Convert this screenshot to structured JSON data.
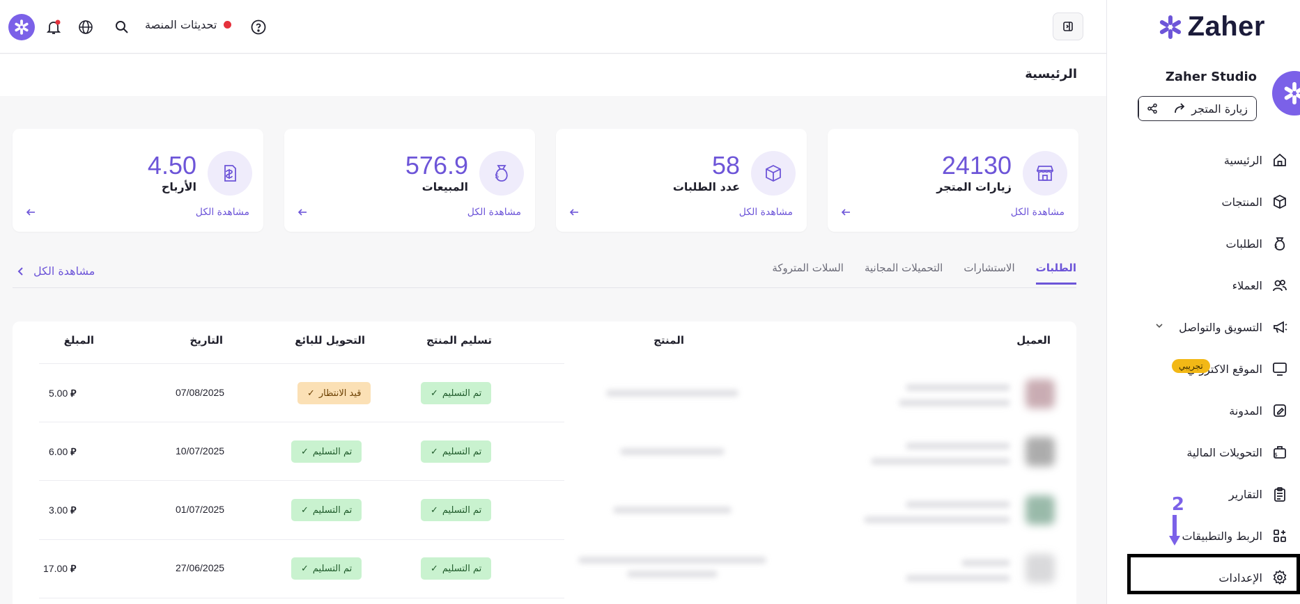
{
  "sidebar": {
    "logo_text": "Zaher",
    "store_name": "Zaher Studio",
    "visit_store": "زيارة المتجر",
    "items": [
      {
        "label": "الرئيسية",
        "icon": "home-icon"
      },
      {
        "label": "المنتجات",
        "icon": "box-icon"
      },
      {
        "label": "الطلبات",
        "icon": "money-bag-icon"
      },
      {
        "label": "العملاء",
        "icon": "users-icon"
      },
      {
        "label": "التسويق والتواصل",
        "icon": "megaphone-icon"
      },
      {
        "label": "الموقع الاكتروني",
        "icon": "monitor-icon",
        "badge": "تجريبي"
      },
      {
        "label": "المدونة",
        "icon": "edit-icon"
      },
      {
        "label": "التحويلات المالية",
        "icon": "transfer-icon"
      },
      {
        "label": "التقارير",
        "icon": "clipboard-icon"
      },
      {
        "label": "الربط والتطبيقات",
        "icon": "apps-icon"
      },
      {
        "label": "الإعدادات",
        "icon": "gear-icon"
      }
    ],
    "step_number": "2"
  },
  "topbar": {
    "updates_label": "تحديثات المنصة"
  },
  "page_title": "الرئيسية",
  "cards": [
    {
      "value": "24130",
      "label": "زيارات المتجر",
      "link": "مشاهدة الكل",
      "icon": "store-icon"
    },
    {
      "value": "58",
      "label": "عدد الطلبات",
      "link": "مشاهدة الكل",
      "icon": "package-icon"
    },
    {
      "value": "576.9",
      "label": "المبيعات",
      "link": "مشاهدة الكل",
      "icon": "money-bag-icon"
    },
    {
      "value": "4.50",
      "label": "الأرباح",
      "link": "مشاهدة الكل",
      "icon": "receipt-icon"
    }
  ],
  "tabs": [
    "الطلبات",
    "الاستشارات",
    "التحميلات المجانية",
    "السلات المتروكة"
  ],
  "see_all": "مشاهدة الكل",
  "table": {
    "headers": {
      "customer": "العميل",
      "product": "المنتج",
      "delivery": "تسليم المنتج",
      "transfer": "التحويل للبائع",
      "date": "التاريخ",
      "amount": "المبلغ"
    },
    "rows": [
      {
        "delivery": "تم التسليم",
        "transfer": "قيد الانتظار",
        "date": "07/08/2025",
        "amount": "5.00"
      },
      {
        "delivery": "تم التسليم",
        "transfer": "تم التسليم",
        "date": "10/07/2025",
        "amount": "6.00"
      },
      {
        "delivery": "تم التسليم",
        "transfer": "تم التسليم",
        "date": "01/07/2025",
        "amount": "3.00"
      },
      {
        "delivery": "تم التسليم",
        "transfer": "تم التسليم",
        "date": "27/06/2025",
        "amount": "17.00"
      }
    ]
  },
  "colors": {
    "accent": "#6d55d8",
    "success_bg": "#c9f2cf",
    "pending_bg": "#fbe0b5",
    "badge": "#f2b816"
  }
}
